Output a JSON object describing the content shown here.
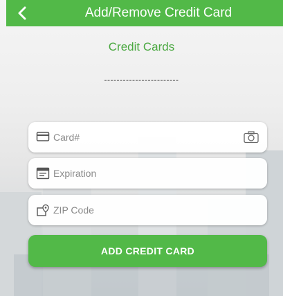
{
  "header": {
    "back_icon": "chevron-left-icon",
    "title": "Add/Remove Credit Card"
  },
  "section_title": "Credit Cards",
  "card_display": "------------------------",
  "form": {
    "card_number": {
      "icon": "credit-card-icon",
      "placeholder": "Card#",
      "value": "",
      "scan_icon": "camera-icon"
    },
    "expiration": {
      "icon": "calendar-icon",
      "placeholder": "Expiration",
      "value": ""
    },
    "zip": {
      "icon": "location-pin-icon",
      "placeholder": "ZIP Code",
      "value": ""
    }
  },
  "add_button_label": "ADD CREDIT CARD",
  "colors": {
    "primary_green": "#52b948",
    "title_green": "#4aa840",
    "field_background": "#ffffff",
    "placeholder": "#8a8a8a"
  }
}
